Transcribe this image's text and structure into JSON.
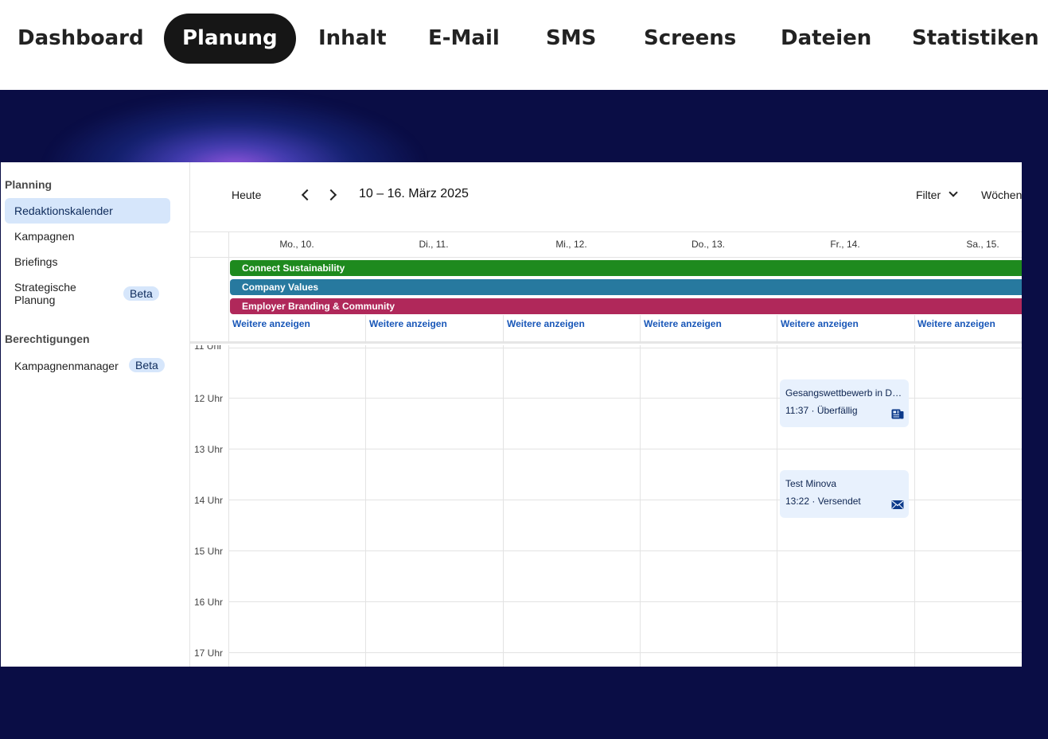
{
  "topnav": {
    "items": [
      {
        "label": "Dashboard",
        "active": false
      },
      {
        "label": "Planung",
        "active": true
      },
      {
        "label": "Inhalt",
        "active": false
      },
      {
        "label": "E-Mail",
        "active": false
      },
      {
        "label": "SMS",
        "active": false
      },
      {
        "label": "Screens",
        "active": false
      },
      {
        "label": "Dateien",
        "active": false
      },
      {
        "label": "Statistiken",
        "active": false
      }
    ]
  },
  "sidebar": {
    "section1_heading": "Planning",
    "items": [
      {
        "label": "Redaktionskalender",
        "active": true
      },
      {
        "label": "Kampagnen"
      },
      {
        "label": "Briefings"
      },
      {
        "label": "Strategische Planung",
        "badge": "Beta"
      }
    ],
    "section2_heading": "Berechtigungen",
    "items2": [
      {
        "label": "Kampagnenmanager",
        "badge": "Beta"
      }
    ]
  },
  "calendar": {
    "today_label": "Heute",
    "date_range": "10 – 16. März 2025",
    "filter_label": "Filter",
    "view_label": "Wöchen",
    "days": [
      "Mo., 10.",
      "Di., 11.",
      "Mi., 12.",
      "Do., 13.",
      "Fr., 14.",
      "Sa., 15."
    ],
    "campaigns": [
      {
        "name": "Connect Sustainability",
        "color": "#1e8a1e"
      },
      {
        "name": "Company Values",
        "color": "#27799f"
      },
      {
        "name": "Employer Branding & Community",
        "color": "#b0285a"
      }
    ],
    "more_label": "Weitere anzeigen",
    "hours": [
      "11 Uhr",
      "12 Uhr",
      "13 Uhr",
      "14 Uhr",
      "15 Uhr",
      "16 Uhr",
      "17 Uhr"
    ],
    "events": [
      {
        "title": "Gesangswettbewerb in Deutschland",
        "time": "11:37",
        "status": "Überfällig",
        "icon": "newspaper-icon"
      },
      {
        "title": "Test Minova",
        "time": "13:22",
        "status": "Versendet",
        "icon": "mail-icon"
      }
    ]
  },
  "colors": {
    "background": "#0a0d45",
    "accent": "#1957b8",
    "active_nav": "#161616",
    "active_sidebar": "#d6e6fb"
  }
}
